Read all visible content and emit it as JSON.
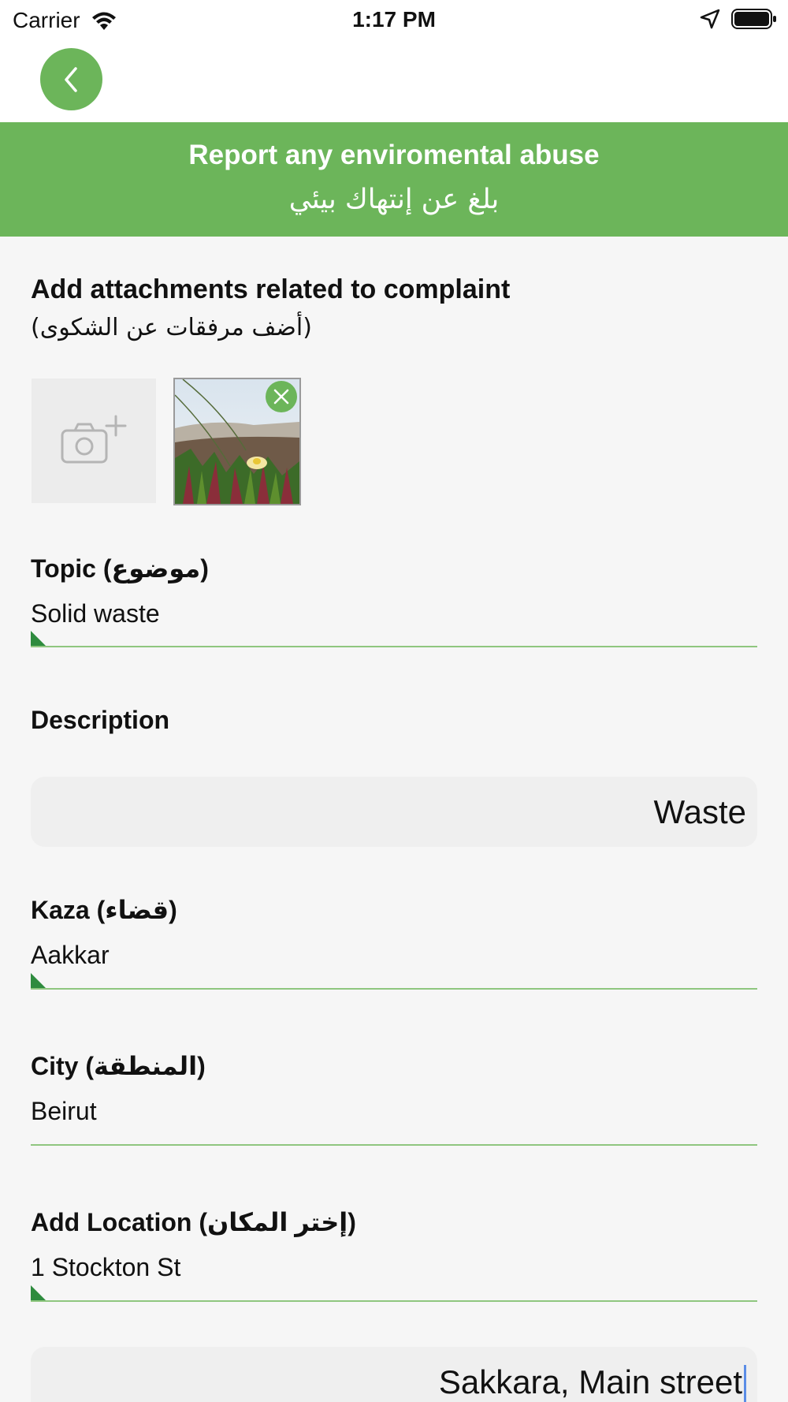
{
  "status_bar": {
    "carrier": "Carrier",
    "time": "1:17 PM"
  },
  "nav": {
    "back_icon": "chevron-left-icon"
  },
  "banner": {
    "title": "Report any enviromental abuse",
    "subtitle": "بلغ عن إنتهاك بيئي"
  },
  "attachments": {
    "title": "Add attachments related to complaint",
    "subtitle": "(أضف مرفقات عن الشكوى)",
    "add_icon": "camera-plus-icon",
    "remove_icon": "close-icon"
  },
  "fields": {
    "topic": {
      "label": "Topic (موضوع)",
      "value": "Solid waste"
    },
    "description": {
      "label": "Description",
      "value": "Waste"
    },
    "kaza": {
      "label": "Kaza (قضاء)",
      "value": "Aakkar"
    },
    "city": {
      "label": "City (المنطقة)",
      "value": "Beirut"
    },
    "location": {
      "label": "Add Location (إختر المكان)",
      "value": "1 Stockton St"
    },
    "address": {
      "value": "Sakkara, Main street"
    }
  },
  "colors": {
    "accent": "#6cb55a",
    "dark_accent": "#2e8b3e",
    "background": "#f6f6f6"
  }
}
